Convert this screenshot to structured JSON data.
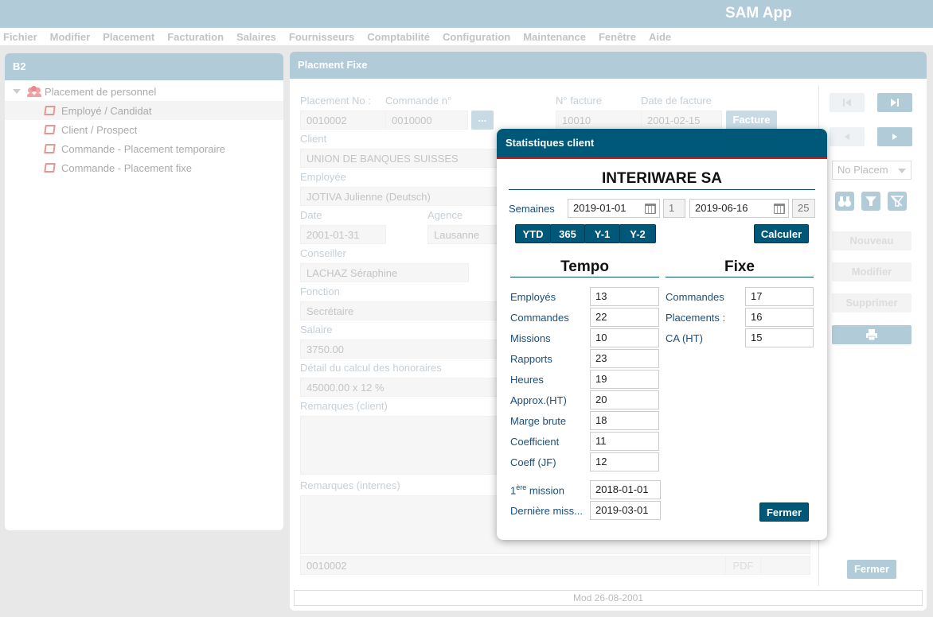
{
  "app": {
    "title": "SAM App"
  },
  "menu": [
    "Fichier",
    "Modifier",
    "Placement",
    "Facturation",
    "Salaires",
    "Fournisseurs",
    "Comptabilité",
    "Configuration",
    "Maintenance",
    "Fenêtre",
    "Aide"
  ],
  "left_panel": {
    "title": "B2",
    "root": "Placement de personnel",
    "items": [
      "Employé / Candidat",
      "Client / Prospect",
      "Commande - Placement temporaire",
      "Commande - Placement fixe"
    ]
  },
  "main_panel": {
    "title": "Placment Fixe",
    "placement_no_label": "Placement No :",
    "placement_no": "0010002",
    "commande_label": "Commande n°",
    "commande": "0010000",
    "dots_label": "...",
    "facture_no_label": "N° facture",
    "facture_no": "10010",
    "facture_date_label": "Date de facture",
    "facture_date": "2001-02-15",
    "facture_button": "Facture",
    "client_label": "Client",
    "client": "UNION DE BANQUES SUISSES",
    "employee_label": "Employée",
    "employee": "JOTIVA Julienne (Deutsch)",
    "date_label": "Date",
    "date": "2001-01-31",
    "agence_label": "Agence",
    "agence": "Lausanne",
    "conseiller_label": "Conseiller",
    "conseiller": "LACHAZ Séraphine",
    "fonction_label": "Fonction",
    "fonction": "Secrétaire",
    "salaire_label": "Salaire",
    "salaire": "3750.00",
    "calcul_label": "Détail du calcul des honoraires",
    "calcul": "45000.00 x 12 %",
    "remarques_client_label": "Remarques (client)",
    "remarques_internes_label": "Remarques (internes)",
    "bottom_ref": "0010002",
    "pdf_button": "PDF",
    "footer_mod": "Mod 26-08-2001",
    "no_placem": "No Placem",
    "nouveau": "Nouveau",
    "modifier": "Modifier",
    "supprimer": "Supprimer",
    "fermer": "Fermer"
  },
  "modal": {
    "title": "Statistiques client",
    "client_name": "INTERIWARE SA",
    "semaines_label": "Semaines",
    "date_from": "2019-01-01",
    "week_from": "1",
    "date_to": "2019-06-16",
    "week_to": "25",
    "quick_buttons": [
      "YTD",
      "365",
      "Y-1",
      "Y-2"
    ],
    "calculer": "Calculer",
    "tempo_title": "Tempo",
    "fixe_title": "Fixe",
    "tempo": [
      {
        "label": "Employés",
        "value": "13"
      },
      {
        "label": "Commandes",
        "value": "22"
      },
      {
        "label": "Missions",
        "value": "10"
      },
      {
        "label": "Rapports",
        "value": "23"
      },
      {
        "label": "Heures",
        "value": "19"
      },
      {
        "label": "Approx.(HT)",
        "value": "20"
      },
      {
        "label": "Marge brute",
        "value": "18"
      },
      {
        "label": "Coefficient",
        "value": "11"
      },
      {
        "label": "Coeff (JF)",
        "value": "12"
      }
    ],
    "fixe": [
      {
        "label": "Commandes",
        "value": "17"
      },
      {
        "label": "Placements :",
        "value": "16"
      },
      {
        "label": "CA (HT)",
        "value": "15"
      }
    ],
    "premiere_mission_pre": "1",
    "premiere_mission_sup": "ère",
    "premiere_mission_post": " mission",
    "premiere_mission": "2018-01-01",
    "derniere_mission_label": "Dernière miss...",
    "derniere_mission": "2019-03-01",
    "fermer": "Fermer"
  }
}
